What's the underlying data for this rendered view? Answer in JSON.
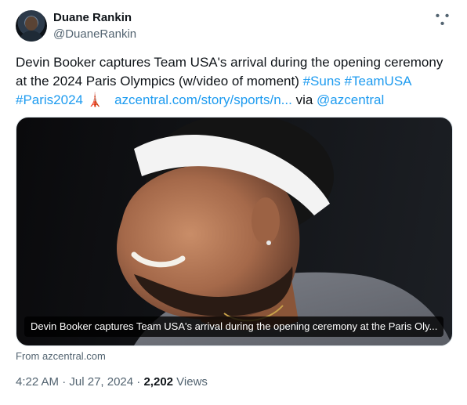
{
  "author": {
    "name": "Duane Rankin",
    "handle": "@DuaneRankin",
    "more_icon": "more-horizontal-icon"
  },
  "tweet": {
    "text_main": "Devin Booker captures Team USA's arrival during the opening ceremony at the 2024 Paris Olympics (w/video of moment) ",
    "hashtag_suns": "#Suns",
    "hashtag_teamusa": "#TeamUSA",
    "hashtag_paris": "#Paris2024",
    "emoji": "🗼",
    "link_text": "azcentral.com/story/sports/n...",
    "via_text": " via ",
    "mention": "@azcentral"
  },
  "media": {
    "caption": "Devin Booker captures Team USA's arrival during the opening ceremony at the Paris Oly...",
    "source": "From azcentral.com"
  },
  "meta": {
    "time": "4:22 AM",
    "separator": " · ",
    "date": "Jul 27, 2024",
    "views_count": "2,202",
    "views_label": " Views"
  },
  "colors": {
    "link": "#1d9bf0",
    "secondary_text": "#536471",
    "primary_text": "#0f1419"
  }
}
